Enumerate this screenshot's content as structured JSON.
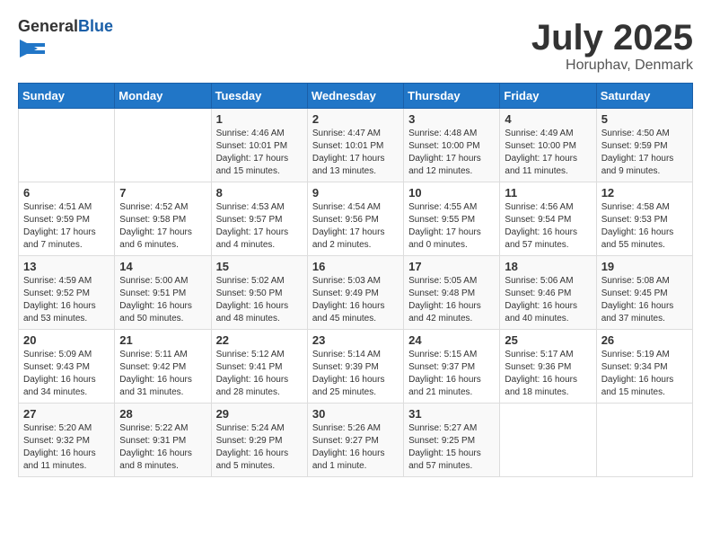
{
  "logo": {
    "general": "General",
    "blue": "Blue"
  },
  "title": "July 2025",
  "subtitle": "Horuphav, Denmark",
  "days_of_week": [
    "Sunday",
    "Monday",
    "Tuesday",
    "Wednesday",
    "Thursday",
    "Friday",
    "Saturday"
  ],
  "weeks": [
    [
      {
        "day": "",
        "info": ""
      },
      {
        "day": "",
        "info": ""
      },
      {
        "day": "1",
        "info": "Sunrise: 4:46 AM\nSunset: 10:01 PM\nDaylight: 17 hours and 15 minutes."
      },
      {
        "day": "2",
        "info": "Sunrise: 4:47 AM\nSunset: 10:01 PM\nDaylight: 17 hours and 13 minutes."
      },
      {
        "day": "3",
        "info": "Sunrise: 4:48 AM\nSunset: 10:00 PM\nDaylight: 17 hours and 12 minutes."
      },
      {
        "day": "4",
        "info": "Sunrise: 4:49 AM\nSunset: 10:00 PM\nDaylight: 17 hours and 11 minutes."
      },
      {
        "day": "5",
        "info": "Sunrise: 4:50 AM\nSunset: 9:59 PM\nDaylight: 17 hours and 9 minutes."
      }
    ],
    [
      {
        "day": "6",
        "info": "Sunrise: 4:51 AM\nSunset: 9:59 PM\nDaylight: 17 hours and 7 minutes."
      },
      {
        "day": "7",
        "info": "Sunrise: 4:52 AM\nSunset: 9:58 PM\nDaylight: 17 hours and 6 minutes."
      },
      {
        "day": "8",
        "info": "Sunrise: 4:53 AM\nSunset: 9:57 PM\nDaylight: 17 hours and 4 minutes."
      },
      {
        "day": "9",
        "info": "Sunrise: 4:54 AM\nSunset: 9:56 PM\nDaylight: 17 hours and 2 minutes."
      },
      {
        "day": "10",
        "info": "Sunrise: 4:55 AM\nSunset: 9:55 PM\nDaylight: 17 hours and 0 minutes."
      },
      {
        "day": "11",
        "info": "Sunrise: 4:56 AM\nSunset: 9:54 PM\nDaylight: 16 hours and 57 minutes."
      },
      {
        "day": "12",
        "info": "Sunrise: 4:58 AM\nSunset: 9:53 PM\nDaylight: 16 hours and 55 minutes."
      }
    ],
    [
      {
        "day": "13",
        "info": "Sunrise: 4:59 AM\nSunset: 9:52 PM\nDaylight: 16 hours and 53 minutes."
      },
      {
        "day": "14",
        "info": "Sunrise: 5:00 AM\nSunset: 9:51 PM\nDaylight: 16 hours and 50 minutes."
      },
      {
        "day": "15",
        "info": "Sunrise: 5:02 AM\nSunset: 9:50 PM\nDaylight: 16 hours and 48 minutes."
      },
      {
        "day": "16",
        "info": "Sunrise: 5:03 AM\nSunset: 9:49 PM\nDaylight: 16 hours and 45 minutes."
      },
      {
        "day": "17",
        "info": "Sunrise: 5:05 AM\nSunset: 9:48 PM\nDaylight: 16 hours and 42 minutes."
      },
      {
        "day": "18",
        "info": "Sunrise: 5:06 AM\nSunset: 9:46 PM\nDaylight: 16 hours and 40 minutes."
      },
      {
        "day": "19",
        "info": "Sunrise: 5:08 AM\nSunset: 9:45 PM\nDaylight: 16 hours and 37 minutes."
      }
    ],
    [
      {
        "day": "20",
        "info": "Sunrise: 5:09 AM\nSunset: 9:43 PM\nDaylight: 16 hours and 34 minutes."
      },
      {
        "day": "21",
        "info": "Sunrise: 5:11 AM\nSunset: 9:42 PM\nDaylight: 16 hours and 31 minutes."
      },
      {
        "day": "22",
        "info": "Sunrise: 5:12 AM\nSunset: 9:41 PM\nDaylight: 16 hours and 28 minutes."
      },
      {
        "day": "23",
        "info": "Sunrise: 5:14 AM\nSunset: 9:39 PM\nDaylight: 16 hours and 25 minutes."
      },
      {
        "day": "24",
        "info": "Sunrise: 5:15 AM\nSunset: 9:37 PM\nDaylight: 16 hours and 21 minutes."
      },
      {
        "day": "25",
        "info": "Sunrise: 5:17 AM\nSunset: 9:36 PM\nDaylight: 16 hours and 18 minutes."
      },
      {
        "day": "26",
        "info": "Sunrise: 5:19 AM\nSunset: 9:34 PM\nDaylight: 16 hours and 15 minutes."
      }
    ],
    [
      {
        "day": "27",
        "info": "Sunrise: 5:20 AM\nSunset: 9:32 PM\nDaylight: 16 hours and 11 minutes."
      },
      {
        "day": "28",
        "info": "Sunrise: 5:22 AM\nSunset: 9:31 PM\nDaylight: 16 hours and 8 minutes."
      },
      {
        "day": "29",
        "info": "Sunrise: 5:24 AM\nSunset: 9:29 PM\nDaylight: 16 hours and 5 minutes."
      },
      {
        "day": "30",
        "info": "Sunrise: 5:26 AM\nSunset: 9:27 PM\nDaylight: 16 hours and 1 minute."
      },
      {
        "day": "31",
        "info": "Sunrise: 5:27 AM\nSunset: 9:25 PM\nDaylight: 15 hours and 57 minutes."
      },
      {
        "day": "",
        "info": ""
      },
      {
        "day": "",
        "info": ""
      }
    ]
  ]
}
